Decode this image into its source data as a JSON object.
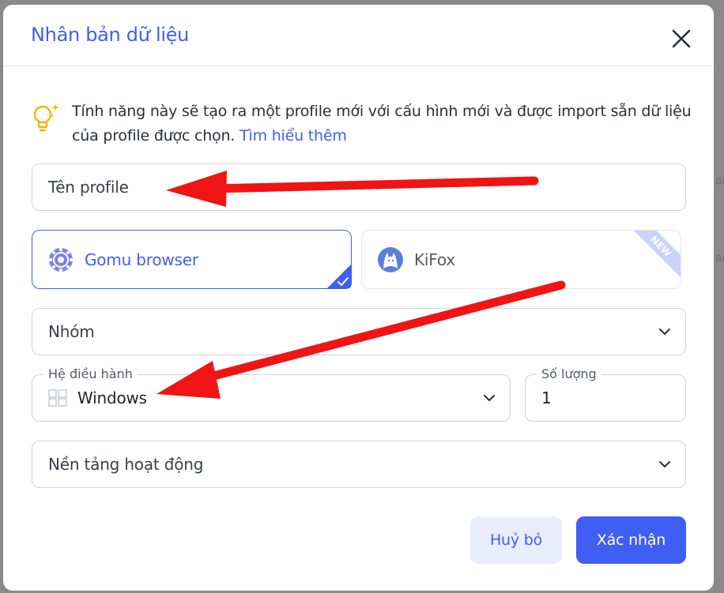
{
  "dialog": {
    "title": "Nhân bản dữ liệu",
    "close_icon": "close-icon"
  },
  "info": {
    "icon": "lightbulb-icon",
    "text": "Tính năng này sẽ tạo ra một profile mới với cấu hình mới và được import sẵn dữ liệu của profile được chọn. ",
    "link": "Tìm hiểu thêm"
  },
  "profile_name": {
    "placeholder": "Tên profile"
  },
  "browsers": [
    {
      "label": "Gomu browser",
      "selected": true,
      "icon": "gomu-browser-icon"
    },
    {
      "label": "KiFox",
      "selected": false,
      "badge": "NEW",
      "icon": "kifox-icon"
    }
  ],
  "group": {
    "placeholder": "Nhóm"
  },
  "os": {
    "label": "Hệ điều hành",
    "value": "Windows",
    "icon": "windows-icon"
  },
  "quantity": {
    "label": "Số lượng",
    "value": "1"
  },
  "platform": {
    "placeholder": "Nền tảng hoạt động"
  },
  "buttons": {
    "cancel": "Huỷ bỏ",
    "confirm": "Xác nhận"
  },
  "colors": {
    "accent": "#3f5ef3",
    "cancel_bg": "#e9edfe",
    "arrow": "#f01414"
  }
}
